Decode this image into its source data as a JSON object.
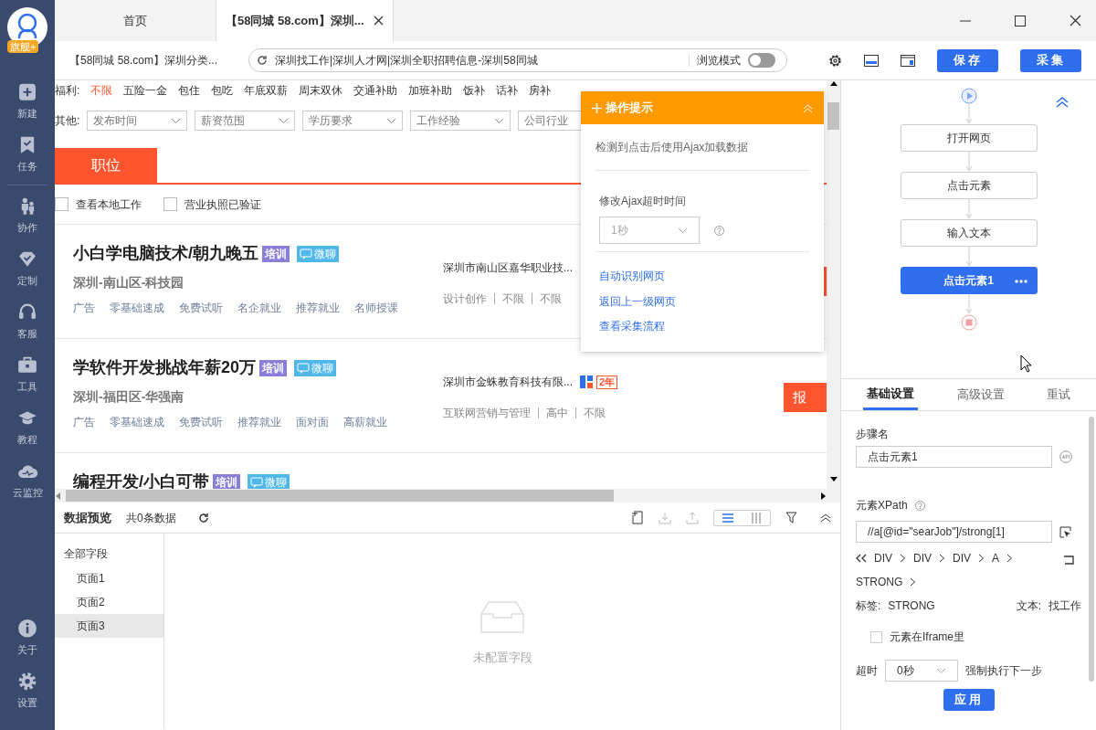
{
  "sidebar": {
    "logo_badge": "旗舰+",
    "items": [
      {
        "kind": "plus",
        "label": "新建"
      },
      {
        "kind": "task",
        "label": "任务"
      },
      {
        "kind": "divider"
      },
      {
        "kind": "team",
        "label": "协作"
      },
      {
        "kind": "custom",
        "label": "定制"
      },
      {
        "kind": "service",
        "label": "客服"
      },
      {
        "kind": "tools",
        "label": "工具"
      },
      {
        "kind": "course",
        "label": "教程"
      },
      {
        "kind": "monitor",
        "label": "云监控"
      }
    ],
    "bottom_items": [
      {
        "kind": "about",
        "label": "关于"
      },
      {
        "kind": "settings",
        "label": "设置"
      }
    ]
  },
  "tabs": [
    {
      "label": "首页",
      "selected": false
    },
    {
      "label": "【58同城 58.com】深圳...",
      "selected": true
    }
  ],
  "address_bar": {
    "page_title": "【58同城 58.com】深圳分类...",
    "url": "深圳找工作|深圳人才网|深圳全职招聘信息-深圳58同城",
    "mode_label": "浏览模式",
    "mode_on": false
  },
  "toolbar_buttons": [
    "保存",
    "采集"
  ],
  "webpage": {
    "welfare_label": "福利:",
    "welfare": [
      {
        "text": "不限",
        "selected": true
      },
      {
        "text": "五险一金",
        "selected": false
      },
      {
        "text": "包住",
        "selected": false
      },
      {
        "text": "包吃",
        "selected": false
      },
      {
        "text": "年底双薪",
        "selected": false
      },
      {
        "text": "周末双休",
        "selected": false
      },
      {
        "text": "交通补助",
        "selected": false
      },
      {
        "text": "加班补助",
        "selected": false
      },
      {
        "text": "饭补",
        "selected": false
      },
      {
        "text": "话补",
        "selected": false
      },
      {
        "text": "房补",
        "selected": false
      }
    ],
    "other_label": "其他:",
    "dropdowns": [
      "发布时间",
      "薪资范围",
      "学历要求",
      "工作经验",
      "公司行业"
    ],
    "tab": "职位",
    "checkboxes": [
      {
        "label": "查看本地工作",
        "checked": false
      },
      {
        "label": "营业执照已验证",
        "checked": false
      }
    ],
    "jobs": [
      {
        "title": "小白学电脑技术/朝九晚五",
        "tags": [
          "培训",
          "微聊"
        ],
        "location": "深圳-南山区-科技园",
        "perks": [
          "广告",
          "零基础速成",
          "免费试听",
          "名企就业",
          "推荐就业",
          "名师授课"
        ],
        "company": "深圳市南山区嘉华职业技...",
        "details": [
          "设计创作",
          "不限",
          "不限"
        ]
      },
      {
        "title": "学软件开发挑战年薪20万",
        "tags": [
          "培训",
          "微聊"
        ],
        "location": "深圳-福田区-华强南",
        "perks": [
          "广告",
          "零基础速成",
          "免费试听",
          "推荐就业",
          "面对面",
          "高薪就业"
        ],
        "company": "深圳市金蛛教育科技有限...",
        "company_badge": "2年",
        "details": [
          "互联网营销与管理",
          "高中",
          "不限"
        ],
        "apply": "报"
      },
      {
        "title": "编程开发/小白可带",
        "tags": [
          "培训",
          "微聊"
        ]
      }
    ]
  },
  "hint_popup": {
    "title": "操作提示",
    "message": "检测到点击后使用Ajax加载数据",
    "timeout_label": "修改Ajax超时时间",
    "timeout_value": "1秒",
    "links": [
      "自动识别网页",
      "返回上一级网页",
      "查看采集流程"
    ]
  },
  "data_preview": {
    "title": "数据预览",
    "count": "共0条数据",
    "views": [
      {
        "kind": "list",
        "selected": true
      },
      {
        "kind": "columns",
        "selected": false
      }
    ],
    "fields_root": "全部字段",
    "pages": [
      {
        "label": "页面1",
        "selected": false
      },
      {
        "label": "页面2",
        "selected": false
      },
      {
        "label": "页面3",
        "selected": true
      }
    ],
    "empty_text": "未配置字段"
  },
  "flow": {
    "steps": [
      {
        "label": "打开网页",
        "selected": false
      },
      {
        "label": "点击元素",
        "selected": false
      },
      {
        "label": "输入文本",
        "selected": false
      },
      {
        "label": "点击元素1",
        "selected": true
      }
    ]
  },
  "settings": {
    "tabs": [
      {
        "label": "基础设置",
        "selected": true
      },
      {
        "label": "高级设置",
        "selected": false
      },
      {
        "label": "重试",
        "selected": false
      }
    ],
    "step_name_label": "步骤名",
    "step_name": "点击元素1",
    "xpath_label": "元素XPath",
    "xpath": "//a[@id=\"searJob\"]/strong[1]",
    "path": [
      "DIV",
      "DIV",
      "DIV",
      "A",
      "STRONG"
    ],
    "tag_label": "标签:",
    "tag": "STRONG",
    "text_label": "文本:",
    "text": "找工作",
    "iframe": {
      "label": "元素在Iframe里",
      "checked": false
    },
    "timeout_label": "超时",
    "timeout_value": "0秒",
    "force_label": "强制执行下一步",
    "apply": "应用"
  }
}
